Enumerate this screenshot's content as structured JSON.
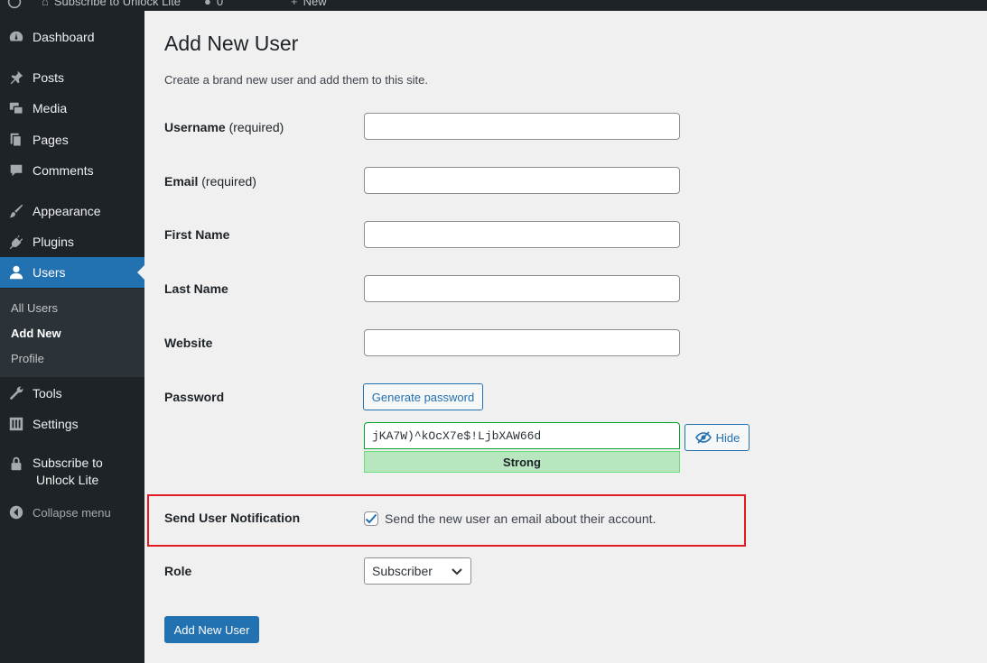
{
  "admin_bar": {
    "site_name": "Subscribe to Unlock Lite",
    "comments_count": "0",
    "new_label": "New"
  },
  "sidebar": {
    "items": [
      {
        "id": "dashboard",
        "label": "Dashboard",
        "icon": "dashboard-icon"
      },
      {
        "id": "posts",
        "label": "Posts",
        "icon": "pin-icon"
      },
      {
        "id": "media",
        "label": "Media",
        "icon": "media-icon"
      },
      {
        "id": "pages",
        "label": "Pages",
        "icon": "pages-icon"
      },
      {
        "id": "comments",
        "label": "Comments",
        "icon": "comment-icon"
      },
      {
        "id": "appearance",
        "label": "Appearance",
        "icon": "brush-icon"
      },
      {
        "id": "plugins",
        "label": "Plugins",
        "icon": "plug-icon"
      },
      {
        "id": "users",
        "label": "Users",
        "icon": "user-icon",
        "active": true
      },
      {
        "id": "tools",
        "label": "Tools",
        "icon": "wrench-icon"
      },
      {
        "id": "settings",
        "label": "Settings",
        "icon": "sliders-icon"
      },
      {
        "id": "subscribe",
        "label_line1": "Subscribe to",
        "label_line2": "Unlock Lite",
        "icon": "lock-icon"
      }
    ],
    "submenu": [
      "All Users",
      "Add New",
      "Profile"
    ],
    "collapse_label": "Collapse menu"
  },
  "page": {
    "title": "Add New User",
    "description": "Create a brand new user and add them to this site."
  },
  "form": {
    "username_label": "Username",
    "email_label": "Email",
    "required_suffix": "(required)",
    "first_name_label": "First Name",
    "last_name_label": "Last Name",
    "website_label": "Website",
    "password_label": "Password",
    "generate_password_button": "Generate password",
    "password_value": "jKA7W)^kOcX7e$!LjbXAW66d",
    "hide_button": "Hide",
    "strength_label": "Strong",
    "notification_label": "Send User Notification",
    "notification_text": "Send the new user an email about their account.",
    "role_label": "Role",
    "role_value": "Subscriber",
    "submit_button": "Add New User"
  },
  "colors": {
    "sidebar_bg": "#1d2327",
    "accent": "#2271b1",
    "highlight_box": "#e01b24",
    "strength_bg": "#b8e6bf"
  }
}
